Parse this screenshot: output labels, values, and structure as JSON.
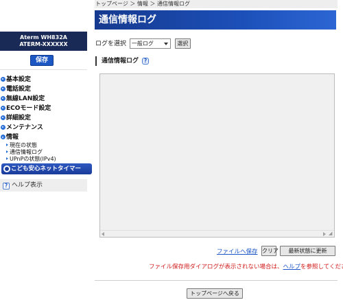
{
  "sidebar": {
    "device_line1": "Aterm WH832A",
    "device_line2": "ATERM-XXXXXX",
    "save_label": "保存",
    "nav": [
      {
        "label": "基本設定"
      },
      {
        "label": "電話設定"
      },
      {
        "label": "無線LAN設定"
      },
      {
        "label": "ECOモード設定"
      },
      {
        "label": "詳細設定"
      },
      {
        "label": "メンテナンス"
      },
      {
        "label": "情報"
      }
    ],
    "sub_items": [
      {
        "label": "現在の状態"
      },
      {
        "label": "通信情報ログ"
      },
      {
        "label": "UPnPの状態(IPv4)"
      }
    ],
    "kids_banner": "こども安心ネットタイマー",
    "help_label": "ヘルプ表示"
  },
  "main": {
    "breadcrumb": "トップページ ＞ 情報 ＞ 通信情報ログ",
    "title": "通信情報ログ",
    "select_label": "ログを選択",
    "select_value": "一般ログ",
    "select_button": "選択",
    "section_title": "通信情報ログ",
    "log_text": "",
    "file_save_link": "ファイルへ保存",
    "clear_button": "クリア",
    "refresh_button": "最新状態に更新",
    "note_prefix": "ファイル保存用ダイアログが表示されない場合は、",
    "note_link": "ヘルプ",
    "note_suffix": "を参照してください。",
    "back_button": "トップページへ戻る"
  },
  "colors": {
    "title_bar": "#1c4fb8",
    "device_box": "#182a55",
    "save_button": "#1d57c4",
    "note_text": "#d21b1b",
    "link": "#1a55c8"
  },
  "icons": {
    "help": "question-icon",
    "nav_bullet": "blue-arrow-circle-icon"
  }
}
